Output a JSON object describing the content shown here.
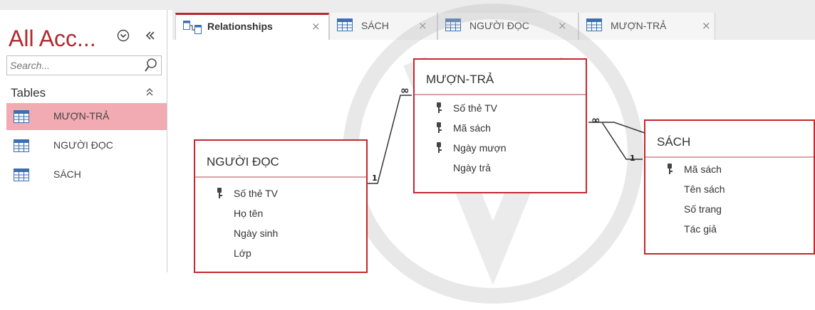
{
  "navigation_pane": {
    "title": "All Acc...",
    "search_placeholder": "Search...",
    "group_label": "Tables",
    "items": [
      {
        "label": "MƯỢN-TRẢ",
        "selected": true
      },
      {
        "label": "NGƯỜI ĐỌC",
        "selected": false
      },
      {
        "label": "SÁCH",
        "selected": false
      }
    ]
  },
  "tabs": [
    {
      "label": "Relationships",
      "close": "×",
      "active": true,
      "icon": "relationships-icon"
    },
    {
      "label": "SÁCH",
      "close": "×",
      "active": false,
      "icon": "table-icon"
    },
    {
      "label": "NGƯỜI ĐỌC",
      "close": "×",
      "active": false,
      "icon": "table-icon"
    },
    {
      "label": "MƯỢN-TRẢ",
      "close": "×",
      "active": false,
      "icon": "table-icon"
    }
  ],
  "relationship_tables": {
    "nguoi_doc": {
      "title": "NGƯỜI ĐỌC",
      "fields": [
        {
          "name": "Số thẻ TV",
          "primary_key": true
        },
        {
          "name": "Họ tên",
          "primary_key": false
        },
        {
          "name": "Ngày sinh",
          "primary_key": false
        },
        {
          "name": "Lớp",
          "primary_key": false
        }
      ]
    },
    "muon_tra": {
      "title": "MƯỢN-TRẢ",
      "fields": [
        {
          "name": "Số thẻ TV",
          "primary_key": true
        },
        {
          "name": "Mã sách",
          "primary_key": true
        },
        {
          "name": "Ngày mượn",
          "primary_key": true
        },
        {
          "name": "Ngày trả",
          "primary_key": false
        }
      ]
    },
    "sach": {
      "title": "SÁCH",
      "fields": [
        {
          "name": "Mã sách",
          "primary_key": true
        },
        {
          "name": "Tên sách",
          "primary_key": false
        },
        {
          "name": "Số trang",
          "primary_key": false
        },
        {
          "name": "Tác giả",
          "primary_key": false
        }
      ]
    }
  },
  "relationships": [
    {
      "from": "NGƯỜI ĐỌC",
      "to": "MƯỢN-TRẢ",
      "one_label": "1",
      "many_label": "∞"
    },
    {
      "from": "SÁCH",
      "to": "MƯỢN-TRẢ",
      "one_label": "1",
      "many_label": "∞"
    }
  ],
  "colors": {
    "accent": "#b02a2e",
    "table_border": "#c6262e",
    "selected_item": "#f2aab3",
    "table_icon": "#3a6fb0"
  }
}
